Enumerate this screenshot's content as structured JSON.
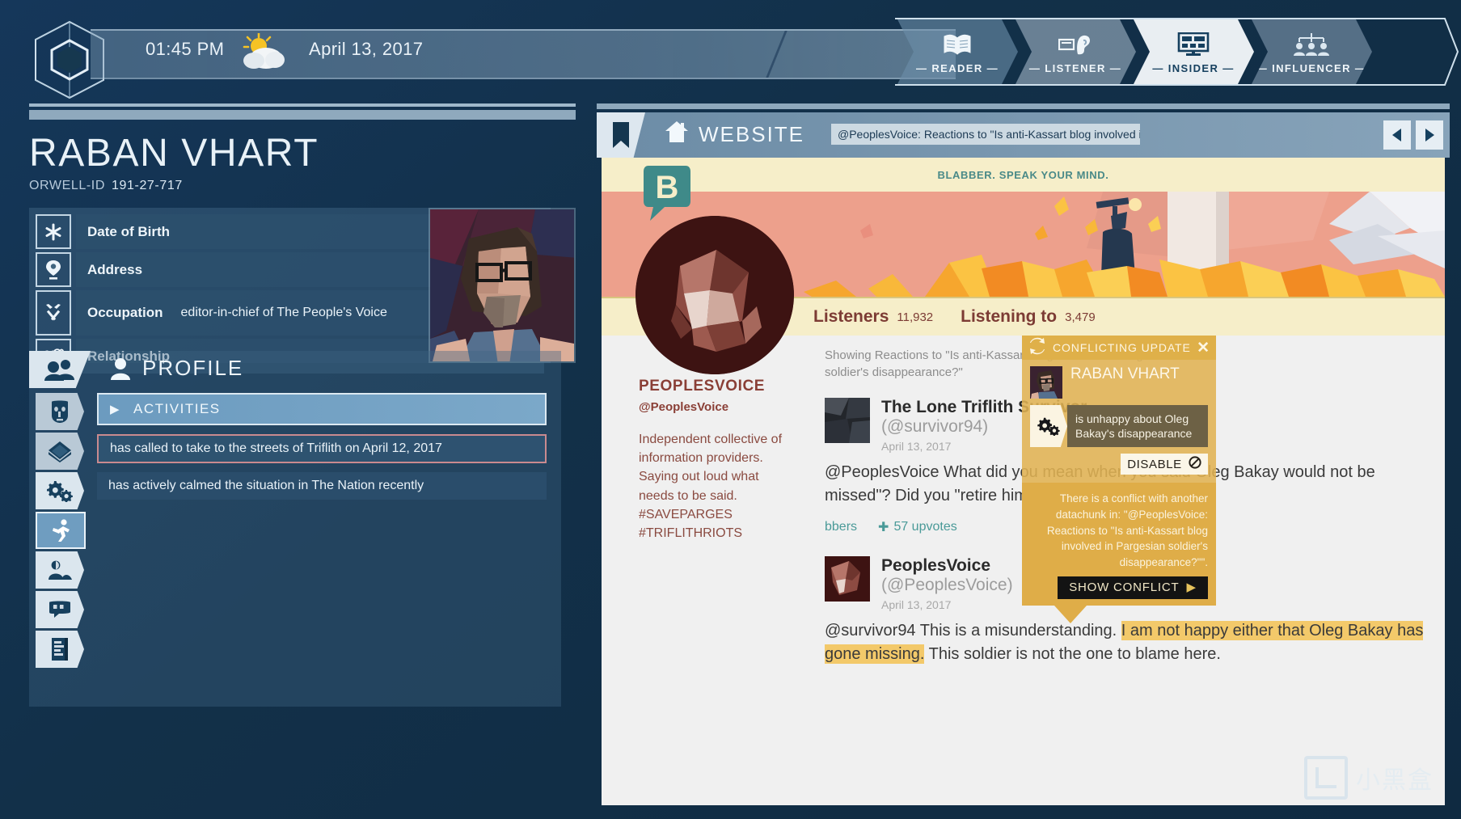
{
  "topbar": {
    "time": "01:45 PM",
    "date": "April 13, 2017",
    "weather_icon": "sun-behind-cloud-icon",
    "logo_icon": "orwell-hex-logo-icon",
    "tabs": [
      {
        "label": "— READER —",
        "icon": "open-book-icon",
        "active": false
      },
      {
        "label": "— LISTENER —",
        "icon": "ear-listening-icon",
        "active": false
      },
      {
        "label": "— INSIDER —",
        "icon": "monitor-screen-icon",
        "active": true
      },
      {
        "label": "— INFLUENCER —",
        "icon": "people-network-icon",
        "active": false
      }
    ]
  },
  "person": {
    "name": "RABAN VHART",
    "orwell_id_label": "ORWELL-ID",
    "orwell_id": "191-27-717",
    "fields": [
      {
        "icon": "asterisk-icon",
        "label": "Date of Birth",
        "value": ""
      },
      {
        "icon": "location-pin-icon",
        "label": "Address",
        "value": ""
      },
      {
        "icon": "tools-icon",
        "label": "Occupation",
        "value": "editor-in-chief of The People's Voice"
      },
      {
        "icon": "hearts-icon",
        "label": "Relationship",
        "value": ""
      }
    ]
  },
  "profile_panel": {
    "tab_icon": "group-people-icon",
    "title": "PROFILE",
    "title_icon": "person-icon",
    "rail": [
      {
        "icon": "face-mask-icon",
        "name": "personality",
        "active": false
      },
      {
        "icon": "book-diamond-icon",
        "name": "biography",
        "active": false
      },
      {
        "icon": "gears-icon",
        "name": "properties",
        "active": false
      },
      {
        "icon": "running-person-icon",
        "name": "activities",
        "active": true
      },
      {
        "icon": "person-scene-icon",
        "name": "whereabouts",
        "active": false
      },
      {
        "icon": "quote-bubble-icon",
        "name": "statements",
        "active": false
      },
      {
        "icon": "documents-icon",
        "name": "documents",
        "active": false
      }
    ],
    "section_header": "ACTIVITIES",
    "activities": [
      {
        "text": "has called to take to the streets of Triflith on April 12, 2017",
        "flagged": true
      },
      {
        "text": "has actively calmed the situation in The Nation recently",
        "flagged": false
      }
    ]
  },
  "browser": {
    "bookmark_icon": "bookmark-icon",
    "home_icon": "home-icon",
    "title": "WEBSITE",
    "url": "@PeoplesVoice: Reactions to \"Is anti-Kassart blog involved in Pa...",
    "prev_icon": "left-arrow-icon",
    "next_icon": "right-arrow-icon"
  },
  "site": {
    "logo_letter": "B",
    "tagline": "BLABBER. SPEAK YOUR MIND.",
    "stats": [
      {
        "label": "Listeners",
        "value": "11,932"
      },
      {
        "label": "Listening to",
        "value": "3,479"
      }
    ],
    "account": {
      "name": "PEOPLESVOICE",
      "handle": "@PeoplesVoice",
      "description": "Independent collective of information providers. Saying out loud what needs to be said.",
      "tags": [
        "#SAVEPARGES",
        "#TRIFLITHRIOTS"
      ]
    },
    "showing": "Showing Reactions to \"Is anti-Kassart blog involved in Pargesian soldier's disappearance?\"",
    "posts": [
      {
        "author": "The Lone Triflith Survivor",
        "handle": "(@survivor94)",
        "date": "April 13, 2017",
        "text": "@PeoplesVoice What did you mean when you said Oleg Bakay would not be missed\"? Did you \"retire him\"?",
        "reply_label": "bbers",
        "upvotes": "57 upvotes",
        "upvote_icon": "plus-icon"
      },
      {
        "author": "PeoplesVoice",
        "handle": "(@PeoplesVoice)",
        "date": "April 13, 2017",
        "text_before": "@survivor94 This is a misunderstanding. ",
        "text_highlight": "I am not happy either that Oleg Bakay has gone missing.",
        "text_after": " This soldier is not the one to blame here.",
        "reply_icon": "reply-arrow-icon"
      }
    ]
  },
  "conflict": {
    "header_icon": "sync-conflict-icon",
    "header_title": "CONFLICTING UPDATE",
    "close_icon": "close-icon",
    "person_name": "RABAN VHART",
    "chunk_icon": "gears-icon",
    "chunk_text": "is unhappy about Oleg Bakay's disappearance",
    "disable_label": "DISABLE",
    "disable_icon": "no-entry-icon",
    "note": "There is a conflict with another datachunk in: \"@PeoplesVoice: Reactions to \"Is anti-Kassart blog involved in Pargesian soldier's disappearance?\"\".",
    "show_label": "SHOW CONFLICT",
    "show_icon": "right-triangle-icon"
  },
  "watermark": {
    "text": "小黑盒",
    "icon": "box-logo-icon"
  },
  "colors": {
    "accent_gold": "#dfb049",
    "teal": "#4a9a98",
    "maroon": "#8a3f36",
    "panel_blue": "#123049",
    "highlight": "#f3c96a"
  }
}
